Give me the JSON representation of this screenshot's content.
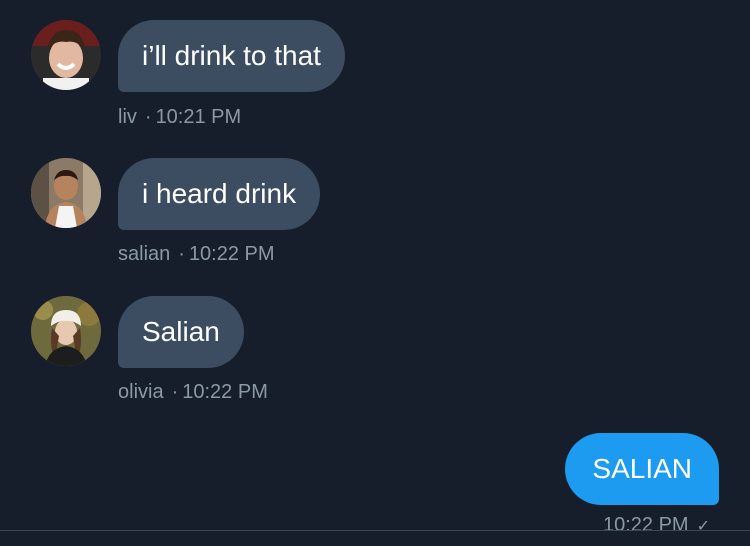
{
  "colors": {
    "background": "#161e2c",
    "incoming_bubble": "#3c4d61",
    "outgoing_bubble": "#1d9bf0",
    "meta_text": "#8b98a6"
  },
  "messages": [
    {
      "sender": "liv",
      "text": "i’ll drink to that",
      "time": "10:21 PM",
      "avatar_icon": "user-avatar"
    },
    {
      "sender": "salian",
      "text": "i heard drink",
      "time": "10:22 PM",
      "avatar_icon": "user-avatar"
    },
    {
      "sender": "olivia",
      "text": "Salian",
      "time": "10:22 PM",
      "avatar_icon": "user-avatar"
    }
  ],
  "outgoing": {
    "text": "SALIAN",
    "time": "10:22 PM",
    "status_icon": "check-icon"
  },
  "separator": "·"
}
